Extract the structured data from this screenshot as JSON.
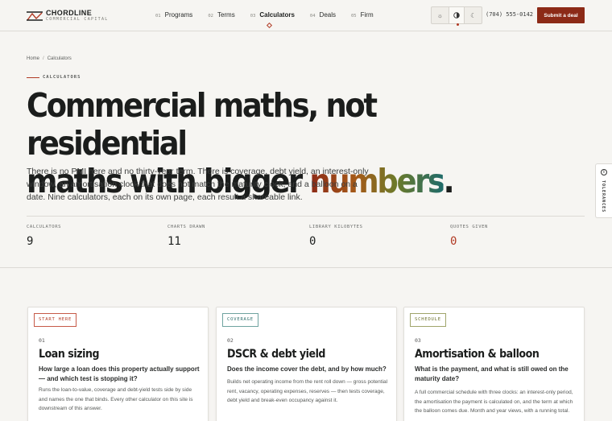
{
  "brand": {
    "name": "CHORDLINE",
    "tagline": "COMMERCIAL CAPITAL"
  },
  "nav": [
    {
      "num": "01",
      "label": "Programs"
    },
    {
      "num": "02",
      "label": "Terms"
    },
    {
      "num": "03",
      "label": "Calculators",
      "active": true
    },
    {
      "num": "04",
      "label": "Deals"
    },
    {
      "num": "05",
      "label": "Firm"
    }
  ],
  "theme": {
    "options": [
      "sun-icon",
      "contrast-icon",
      "moon-icon"
    ],
    "selected": "contrast-icon"
  },
  "phone": "(704) 555-0142",
  "cta_label": "Submit a deal",
  "breadcrumb": {
    "home": "Home",
    "sep": "/",
    "current": "Calculators"
  },
  "eyebrow": "CALCULATORS",
  "headline": {
    "part1": "Commercial maths, not residential",
    "part2": "maths with bigger ",
    "highlight": "numbers",
    "end": "."
  },
  "lede": "There is no PMI here and no thirty-year term. There is coverage, debt yield, an interest-only window, an amortisation clock that does not match the maturity clock, and a balloon on a date. Nine calculators, each on its own page, each result a shareable link.",
  "stats": [
    {
      "label": "CALCULATORS",
      "value": "9"
    },
    {
      "label": "CHARTS DRAWN",
      "value": "11"
    },
    {
      "label": "LIBRARY KILOBYTES",
      "value": "0"
    },
    {
      "label": "QUOTES GIVEN",
      "value": "0",
      "accent": true
    }
  ],
  "side_tab": "TOLERANCES",
  "cards": [
    {
      "tag": "START HERE",
      "num": "01",
      "title": "Loan sizing",
      "question": "How large a loan does this property actually support — and which test is stopping it?",
      "body": "Runs the loan-to-value, coverage and debt-yield tests side by side and names the one that binds. Every other calculator on this site is downstream of this answer."
    },
    {
      "tag": "COVERAGE",
      "num": "02",
      "title": "DSCR & debt yield",
      "question": "Does the income cover the debt, and by how much?",
      "body": "Builds net operating income from the rent roll down — gross potential rent, vacancy, operating expenses, reserves — then tests coverage, debt yield and break-even occupancy against it."
    },
    {
      "tag": "SCHEDULE",
      "num": "03",
      "title": "Amortisation & balloon",
      "question": "What is the payment, and what is still owed on the maturity date?",
      "body": "A full commercial schedule with three clocks: an interest-only period, the amortisation the payment is calculated on, and the term at which the balloon comes due. Month and year views, with a running total."
    }
  ],
  "colors": {
    "accent": "#b13a24",
    "cta": "#8c2a17",
    "teal": "#2f6f6c",
    "olive": "#6a6f2a"
  }
}
